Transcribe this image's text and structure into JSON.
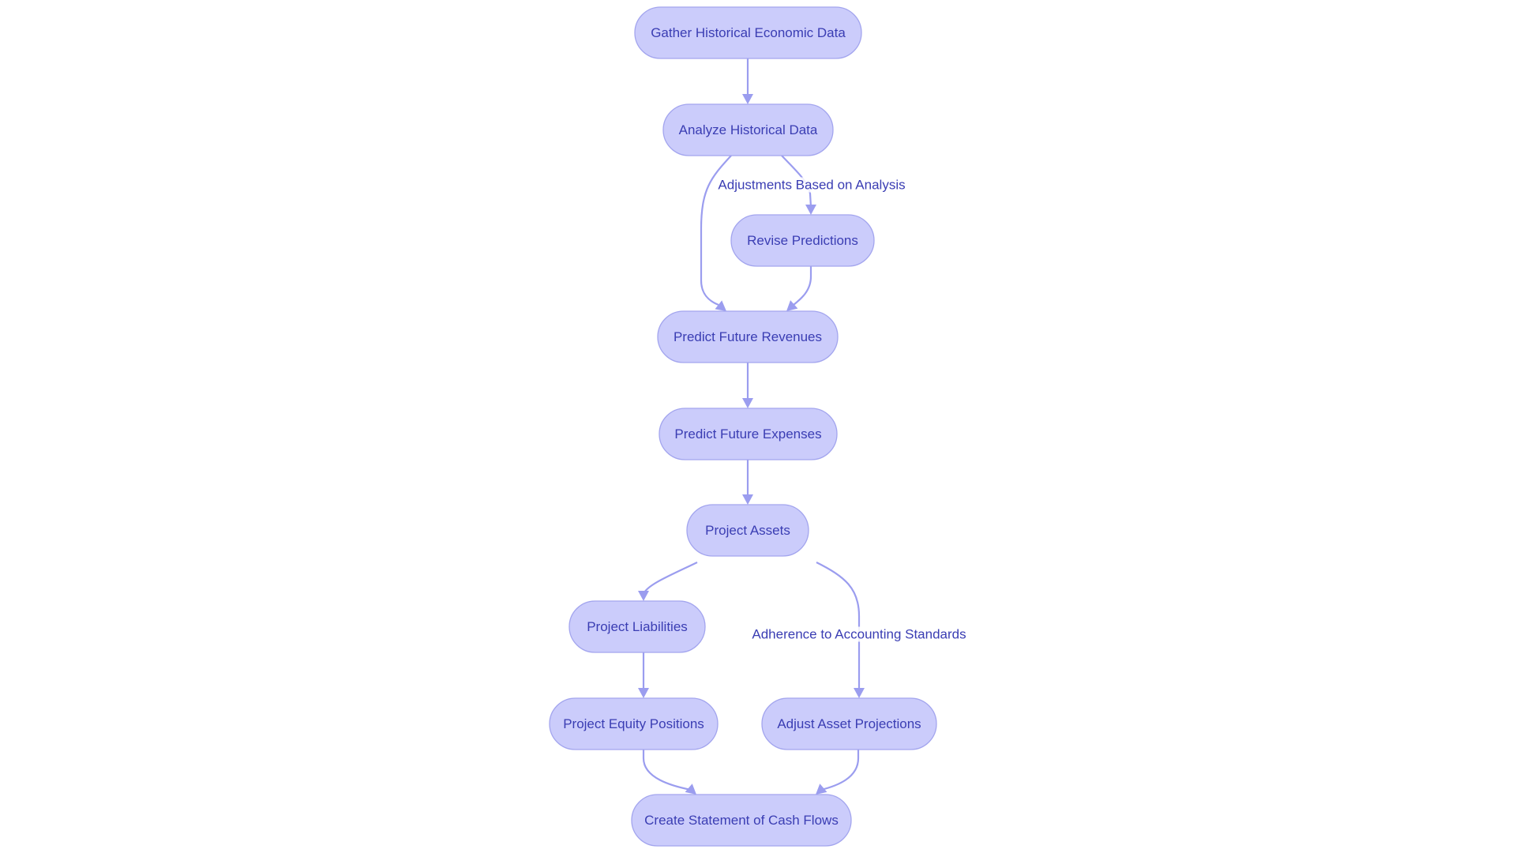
{
  "diagram": {
    "type": "flowchart",
    "direction": "top-to-bottom",
    "colors": {
      "node_fill": "#cbccfb",
      "node_stroke": "#a3a5ee",
      "edge": "#9b9def",
      "text": "#3a3db3"
    },
    "nodes": [
      {
        "id": "gather",
        "label": "Gather Historical Economic Data"
      },
      {
        "id": "analyze",
        "label": "Analyze Historical Data"
      },
      {
        "id": "revise",
        "label": "Revise Predictions"
      },
      {
        "id": "revenues",
        "label": "Predict Future Revenues"
      },
      {
        "id": "expenses",
        "label": "Predict Future Expenses"
      },
      {
        "id": "assets",
        "label": "Project Assets"
      },
      {
        "id": "liabilities",
        "label": "Project Liabilities"
      },
      {
        "id": "equity",
        "label": "Project Equity Positions"
      },
      {
        "id": "adjust",
        "label": "Adjust Asset Projections"
      },
      {
        "id": "cashflows",
        "label": "Create Statement of Cash Flows"
      }
    ],
    "edges": [
      {
        "from": "gather",
        "to": "analyze",
        "label": ""
      },
      {
        "from": "analyze",
        "to": "revenues",
        "label": ""
      },
      {
        "from": "analyze",
        "to": "revise",
        "label": "Adjustments Based on Analysis"
      },
      {
        "from": "revise",
        "to": "revenues",
        "label": ""
      },
      {
        "from": "revenues",
        "to": "expenses",
        "label": ""
      },
      {
        "from": "expenses",
        "to": "assets",
        "label": ""
      },
      {
        "from": "assets",
        "to": "liabilities",
        "label": ""
      },
      {
        "from": "assets",
        "to": "adjust",
        "label": "Adherence to Accounting Standards"
      },
      {
        "from": "liabilities",
        "to": "equity",
        "label": ""
      },
      {
        "from": "equity",
        "to": "cashflows",
        "label": ""
      },
      {
        "from": "adjust",
        "to": "cashflows",
        "label": ""
      }
    ]
  }
}
